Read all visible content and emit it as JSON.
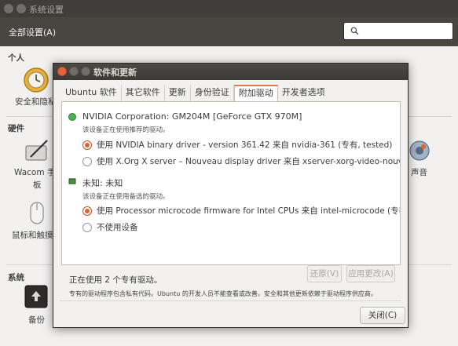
{
  "background": {
    "window_title": "系统设置",
    "all_settings": "全部设置(A)",
    "search_placeholder": "",
    "sections": {
      "personal": "个人",
      "hardware": "硬件",
      "system": "系统"
    },
    "items": {
      "security_privacy": "安全和隐私",
      "wacom_line1": "Wacom 手",
      "wacom_line2": "板",
      "mouse_touchpad": "鼠标和触摸",
      "backup": "备份",
      "sound": "声音"
    }
  },
  "dialog": {
    "title": "软件和更新",
    "tabs": [
      {
        "label": "Ubuntu 软件",
        "active": false
      },
      {
        "label": "其它软件",
        "active": false
      },
      {
        "label": "更新",
        "active": false
      },
      {
        "label": "身份验证",
        "active": false
      },
      {
        "label": "附加驱动",
        "active": true
      },
      {
        "label": "开发者选项",
        "active": false
      }
    ],
    "devices": [
      {
        "name": "NVIDIA Corporation: GM204M [GeForce GTX 970M]",
        "note": "该设备正在使用推荐的驱动。",
        "status_color": "#4caf50",
        "options": [
          {
            "label": "使用 NVIDIA binary driver - version 361.42 来自 nvidia-361 (专有, tested)",
            "checked": true
          },
          {
            "label": "使用 X.Org X server – Nouveau display driver 来自 xserver-xorg-video-nouveau (开",
            "checked": false
          }
        ]
      },
      {
        "name": "未知: 未知",
        "note": "该设备正在使用备选的驱动。",
        "status_color": "#4a8f3a",
        "options": [
          {
            "label": "使用 Processor microcode firmware for Intel CPUs 来自 intel-microcode (专有)",
            "checked": true
          },
          {
            "label": "不使用设备",
            "checked": false
          }
        ]
      }
    ],
    "status_text": "正在使用 2 个专有驱动。",
    "revert_label": "还原(V)",
    "apply_label": "应用更改(A)",
    "footnote": "专有的驱动程序包含私有代码。Ubuntu 的开发人员不能查看或改善。安全和其他更新依赖于驱动程序供应商。",
    "close_label": "关闭(C)"
  },
  "colors": {
    "accent": "#e0642f",
    "titlebar": "#3f3e3a",
    "toolbar": "#474640"
  }
}
